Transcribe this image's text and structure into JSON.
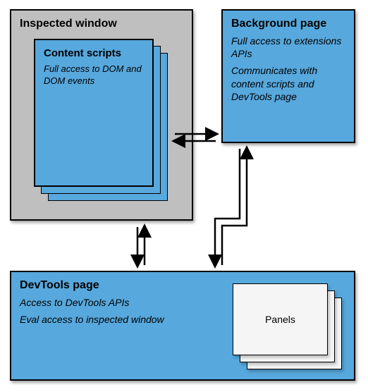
{
  "inspected_window": {
    "title": "Inspected window"
  },
  "content_scripts": {
    "title": "Content scripts",
    "body": "Full access to DOM and DOM events"
  },
  "background_page": {
    "title": "Background page",
    "body1": "Full access to extensions APIs",
    "body2": "Communicates with content scripts and DevTools page"
  },
  "devtools_page": {
    "title": "DevTools page",
    "body1": "Access to DevTools APIs",
    "body2": "Eval access to inspected window"
  },
  "panels": {
    "label": "Panels"
  }
}
